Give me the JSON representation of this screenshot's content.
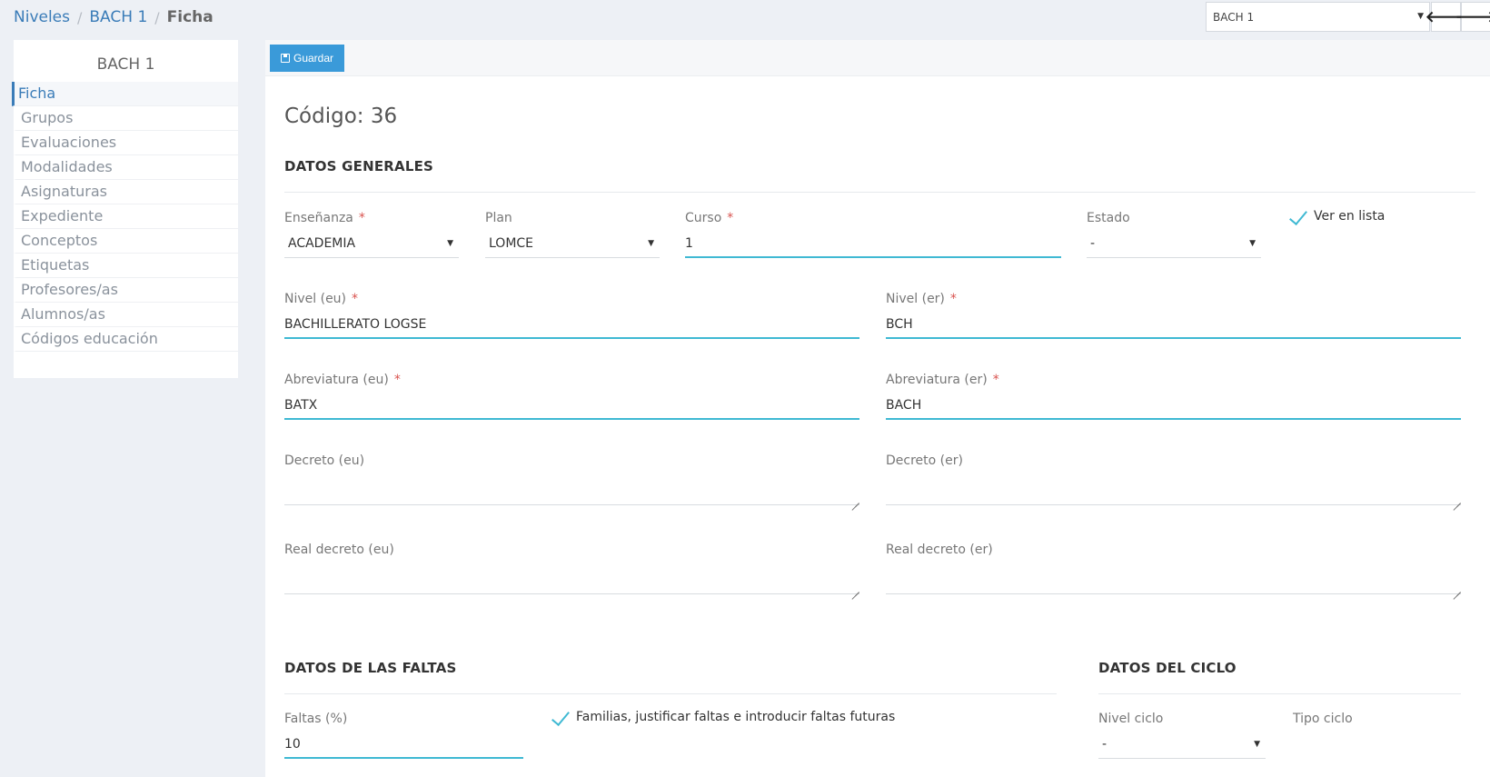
{
  "breadcrumb": {
    "items": [
      "Niveles",
      "BACH 1"
    ],
    "separator": "/",
    "current": "Ficha"
  },
  "top_select": {
    "value": "BACH 1"
  },
  "nav": {
    "prev_icon": "arrow-left-icon",
    "next_icon": "arrow-right-icon"
  },
  "sidebar": {
    "title": "BACH 1",
    "items": [
      {
        "label": "Ficha",
        "active": true
      },
      {
        "label": "Grupos"
      },
      {
        "label": "Evaluaciones"
      },
      {
        "label": "Modalidades"
      },
      {
        "label": "Asignaturas"
      },
      {
        "label": "Expediente"
      },
      {
        "label": "Conceptos"
      },
      {
        "label": "Etiquetas"
      },
      {
        "label": "Profesores/as"
      },
      {
        "label": "Alumnos/as"
      },
      {
        "label": "Códigos educación"
      }
    ]
  },
  "toolbar": {
    "save_label": "Guardar"
  },
  "form": {
    "code_title": "Código: 36",
    "required_mark": "*",
    "general": {
      "title": "DATOS GENERALES",
      "ensenanza": {
        "label": "Enseñanza",
        "value": "ACADEMIA"
      },
      "plan": {
        "label": "Plan",
        "value": "LOMCE"
      },
      "curso": {
        "label": "Curso",
        "value": "1"
      },
      "estado": {
        "label": "Estado",
        "value": "-"
      },
      "ver_en_lista": {
        "label": "Ver en lista",
        "checked": true
      },
      "nivel_eu": {
        "label": "Nivel (eu)",
        "value": "BACHILLERATO LOGSE"
      },
      "nivel_er": {
        "label": "Nivel (er)",
        "value": "BCH"
      },
      "abrev_eu": {
        "label": "Abreviatura (eu)",
        "value": "BATX"
      },
      "abrev_er": {
        "label": "Abreviatura (er)",
        "value": "BACH"
      },
      "decreto_eu": {
        "label": "Decreto (eu)",
        "value": ""
      },
      "decreto_er": {
        "label": "Decreto (er)",
        "value": ""
      },
      "real_decreto_eu": {
        "label": "Real decreto (eu)",
        "value": ""
      },
      "real_decreto_er": {
        "label": "Real decreto (er)",
        "value": ""
      }
    },
    "faltas": {
      "title": "DATOS DE LAS FALTAS",
      "faltas_pct": {
        "label": "Faltas (%)",
        "value": "10"
      },
      "familias": {
        "label": "Familias, justificar faltas e introducir faltas futuras",
        "checked": true
      }
    },
    "ciclo": {
      "title": "DATOS DEL CICLO",
      "nivel_ciclo": {
        "label": "Nivel ciclo",
        "value": "-"
      },
      "tipo_ciclo": {
        "label": "Tipo ciclo"
      }
    }
  }
}
